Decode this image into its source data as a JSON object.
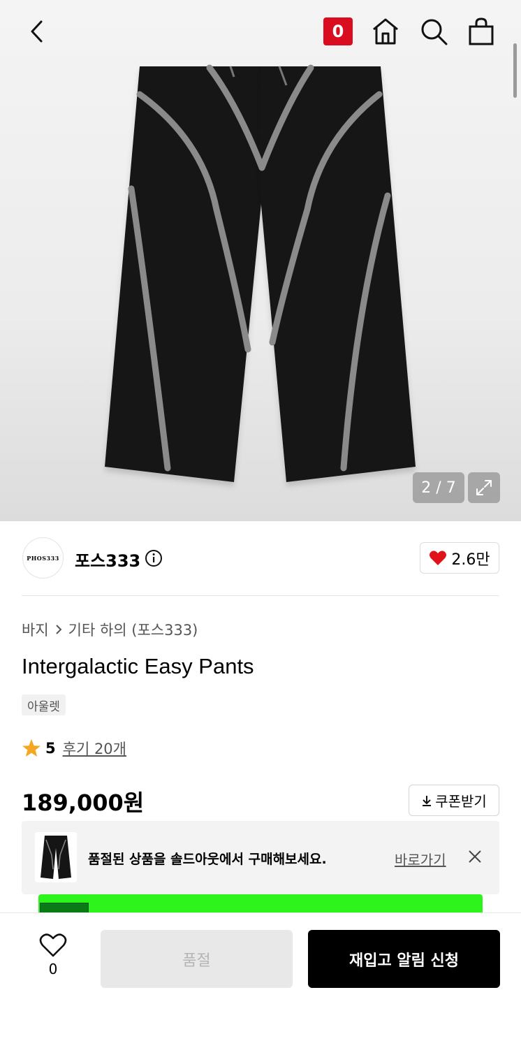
{
  "header": {
    "badge_text": "0",
    "icons": [
      "back-icon",
      "home-icon",
      "search-icon",
      "bag-icon"
    ]
  },
  "gallery": {
    "counter": "2 / 7"
  },
  "brand": {
    "logo_text": "PHOS333",
    "name": "포스333",
    "likes": "2.6만",
    "like_color": "#e0121a"
  },
  "product": {
    "breadcrumb": [
      "바지",
      "기타 하의 (포스333)"
    ],
    "title": "Intergalactic Easy Pants",
    "tag": "아울렛",
    "rating_score": "5",
    "reviews": "후기 20개",
    "price": "189,000원",
    "coupon_label": "쿠폰받기",
    "star_color": "#f5a623"
  },
  "soldout_banner": {
    "text": "품절된 상품을 솔드아웃에서 구매해보세요.",
    "link": "바로가기"
  },
  "bottom_bar": {
    "wish_count": "0",
    "soldout_label": "품절",
    "restock_label": "재입고 알림 신청"
  }
}
